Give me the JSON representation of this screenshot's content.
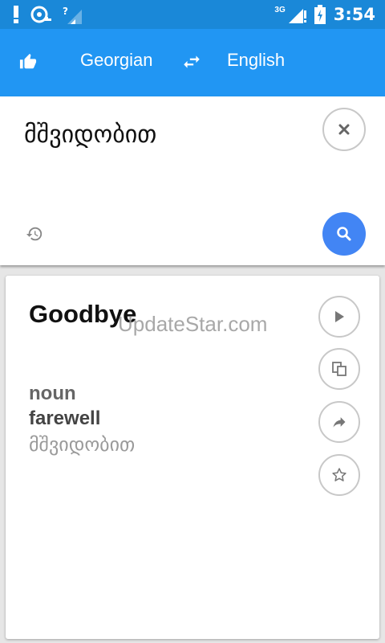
{
  "status_bar": {
    "left_icons": [
      "alert-icon",
      "sync-icon",
      "wifi-unknown-icon"
    ],
    "network": "3G",
    "right_icons": [
      "signal-icon",
      "battery-icon"
    ],
    "time": "3:54"
  },
  "app_bar": {
    "source_language": "Georgian",
    "target_language": "English",
    "icons": [
      "thumbs-up-icon",
      "swap-icon"
    ],
    "color": "#2196f3"
  },
  "input": {
    "text": "მშვიდობით",
    "icons": [
      "close-icon",
      "history-icon",
      "search-icon"
    ],
    "search_color": "#4285f4"
  },
  "result": {
    "translation": "Goodbye",
    "watermark": "UpdateStar.com",
    "part_of_speech": "noun",
    "definition": "farewell",
    "native": "მშვიდობით",
    "actions": [
      "play-icon",
      "copy-icon",
      "share-icon",
      "star-icon"
    ]
  }
}
